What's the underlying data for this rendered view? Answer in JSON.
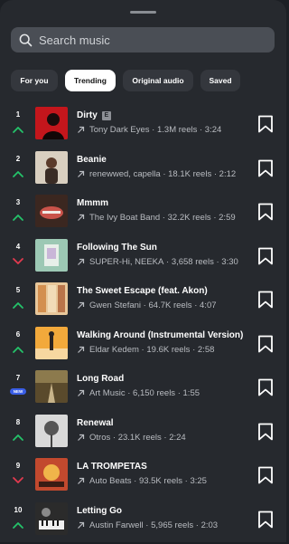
{
  "search": {
    "placeholder": "Search music",
    "icon": "search-icon"
  },
  "tabs": [
    {
      "label": "For you",
      "active": false
    },
    {
      "label": "Trending",
      "active": true
    },
    {
      "label": "Original audio",
      "active": false
    },
    {
      "label": "Saved",
      "active": false
    }
  ],
  "colors": {
    "up": "#24c36a",
    "down": "#e23a4f",
    "new_badge": "#3a5ee6"
  },
  "tracks": [
    {
      "rank": "1",
      "trend": "up",
      "title": "Dirty",
      "explicit": "E",
      "artist": "Tony Dark Eyes",
      "reels": "1.3M reels",
      "duration": "3:24"
    },
    {
      "rank": "2",
      "trend": "up",
      "title": "Beanie",
      "artist": "renewwed, capella",
      "reels": "18.1K reels",
      "duration": "2:12"
    },
    {
      "rank": "3",
      "trend": "up",
      "title": "Mmmm",
      "artist": "The Ivy Boat Band",
      "reels": "32.2K reels",
      "duration": "2:59"
    },
    {
      "rank": "4",
      "trend": "down",
      "title": "Following The Sun",
      "artist": "SUPER-Hi, NEEKA",
      "reels": "3,658 reels",
      "duration": "3:30"
    },
    {
      "rank": "5",
      "trend": "up",
      "title": "The Sweet Escape (feat. Akon)",
      "artist": "Gwen Stefani",
      "reels": "64.7K reels",
      "duration": "4:07"
    },
    {
      "rank": "6",
      "trend": "up",
      "title": "Walking Around (Instrumental Version)",
      "artist": "Eldar Kedem",
      "reels": "19.6K reels",
      "duration": "2:58"
    },
    {
      "rank": "7",
      "trend": "new",
      "badge": "NEW",
      "title": "Long Road",
      "artist": "Art Music",
      "reels": "6,150 reels",
      "duration": "1:55"
    },
    {
      "rank": "8",
      "trend": "up",
      "title": "Renewal",
      "artist": "Otros",
      "reels": "23.1K reels",
      "duration": "2:24"
    },
    {
      "rank": "9",
      "trend": "down",
      "title": "LA TROMPETAS",
      "artist": "Auto Beats",
      "reels": "93.5K reels",
      "duration": "3:25"
    },
    {
      "rank": "10",
      "trend": "up",
      "title": "Letting Go",
      "artist": "Austin Farwell",
      "reels": "5,965 reels",
      "duration": "2:03"
    }
  ]
}
